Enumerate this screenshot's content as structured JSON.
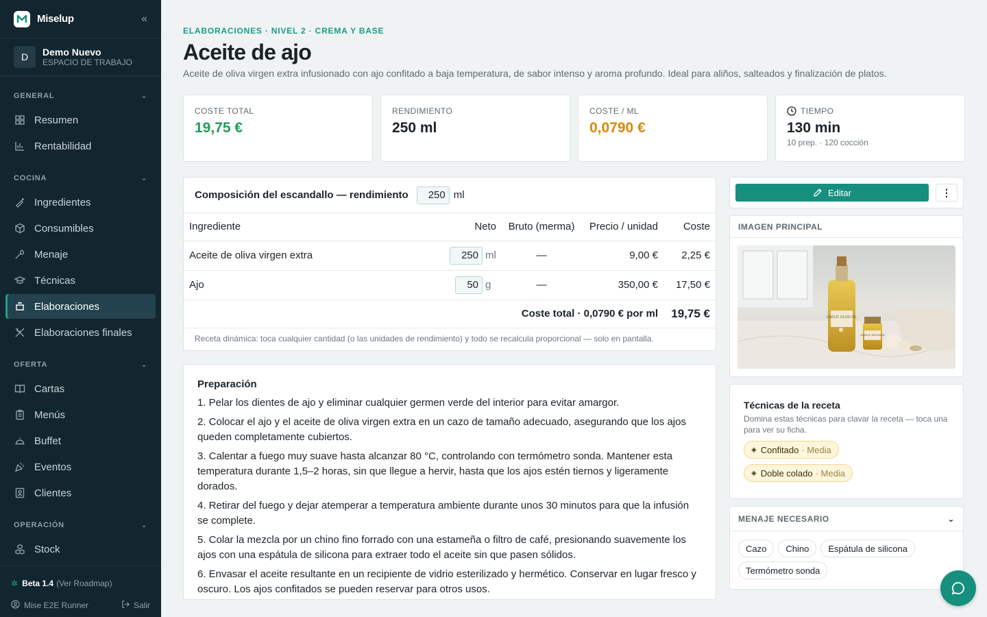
{
  "sidebar": {
    "brand": "Miselup",
    "workspace": {
      "initial": "D",
      "name": "Demo Nuevo",
      "subtitle": "ESPACIO DE TRABAJO"
    },
    "sections": {
      "general": {
        "label": "GENERAL",
        "items": [
          "Resumen",
          "Rentabilidad"
        ]
      },
      "cocina": {
        "label": "COCINA",
        "items": [
          "Ingredientes",
          "Consumibles",
          "Menaje",
          "Técnicas",
          "Elaboraciones",
          "Elaboraciones finales"
        ]
      },
      "oferta": {
        "label": "OFERTA",
        "items": [
          "Cartas",
          "Menús",
          "Buffet",
          "Eventos",
          "Clientes"
        ]
      },
      "operacion": {
        "label": "OPERACIÓN",
        "items": [
          "Stock"
        ]
      }
    },
    "footer": {
      "beta": "Beta 1.4",
      "roadmap": "(Ver Roadmap)",
      "user": "Mise E2E Runner",
      "logout": "Salir"
    }
  },
  "page": {
    "breadcrumb": "ELABORACIONES  · NIVEL 2 · CREMA Y BASE",
    "title": "Aceite de ajo",
    "description": "Aceite de oliva virgen extra infusionado con ajo confitado a baja temperatura, de sabor intenso y aroma profundo. Ideal para aliños, salteados y finalización de platos."
  },
  "stats": {
    "cost": {
      "label": "COSTE TOTAL",
      "value": "19,75 €",
      "color": "#1f9d55"
    },
    "yield": {
      "label": "RENDIMIENTO",
      "value": "250 ml"
    },
    "per_ml": {
      "label": "COSTE / ML",
      "value": "0,0790 €",
      "color": "#d68a0c"
    },
    "time": {
      "label": "TIEMPO",
      "value": "130 min",
      "sub": "10 prep. · 120 cocción"
    }
  },
  "composition": {
    "title": "Composición del escandallo — rendimiento",
    "yield_value": "250",
    "yield_unit": "ml",
    "headers": {
      "ingredient": "Ingrediente",
      "net": "Neto",
      "gross": "Bruto (merma)",
      "price": "Precio / unidad",
      "cost": "Coste"
    },
    "rows": [
      {
        "name": "Aceite de oliva virgen extra",
        "qty": "250",
        "unit": "ml",
        "gross": "—",
        "price": "9,00 €",
        "cost": "2,25 €"
      },
      {
        "name": "Ajo",
        "qty": "50",
        "unit": "g",
        "gross": "—",
        "price": "350,00 €",
        "cost": "17,50 €"
      }
    ],
    "total_label": "Coste total · 0,0790 € por ml",
    "total_value": "19,75 €",
    "note": "Receta dinámica: toca cualquier cantidad (o las unidades de rendimiento) y todo se recalcula proporcional — solo en pantalla."
  },
  "preparation": {
    "title": "Preparación",
    "steps": [
      "1. Pelar los dientes de ajo y eliminar cualquier germen verde del interior para evitar amargor.",
      "2. Colocar el ajo y el aceite de oliva virgen extra en un cazo de tamaño adecuado, asegurando que los ajos queden completamente cubiertos.",
      "3. Calentar a fuego muy suave hasta alcanzar 80 °C, controlando con termómetro sonda. Mantener esta temperatura durante 1,5–2 horas, sin que llegue a hervir, hasta que los ajos estén tiernos y ligeramente dorados.",
      "4. Retirar del fuego y dejar atemperar a temperatura ambiente durante unos 30 minutos para que la infusión se complete.",
      "5. Colar la mezcla por un chino fino forrado con una estameña o filtro de café, presionando suavemente los ajos con una espátula de silicona para extraer todo el aceite sin que pasen sólidos.",
      "6. Envasar el aceite resultante en un recipiente de vidrio esterilizado y hermético. Conservar en lugar fresco y oscuro. Los ajos confitados se pueden reservar para otros usos."
    ]
  },
  "right": {
    "edit_label": "Editar",
    "more_label": "⋮",
    "image_title": "IMAGEN PRINCIPAL",
    "image_labels": {
      "bottle": "GARLIC OLIVE OIL",
      "jar": "GARLIC INFUSION"
    },
    "techniques": {
      "title": "Técnicas de la receta",
      "subtitle": "Domina estas técnicas para clavar la receta — toca una para ver su ficha.",
      "items": [
        {
          "name": "Confitado",
          "level": "· Media"
        },
        {
          "name": "Doble colado",
          "level": "· Media"
        }
      ]
    },
    "menaje": {
      "title": "MENAJE NECESARIO",
      "items": [
        "Cazo",
        "Chino",
        "Espátula de silicona",
        "Termómetro sonda"
      ]
    }
  },
  "colors": {
    "accent": "#168f7e",
    "sidebar": "#12262f"
  }
}
